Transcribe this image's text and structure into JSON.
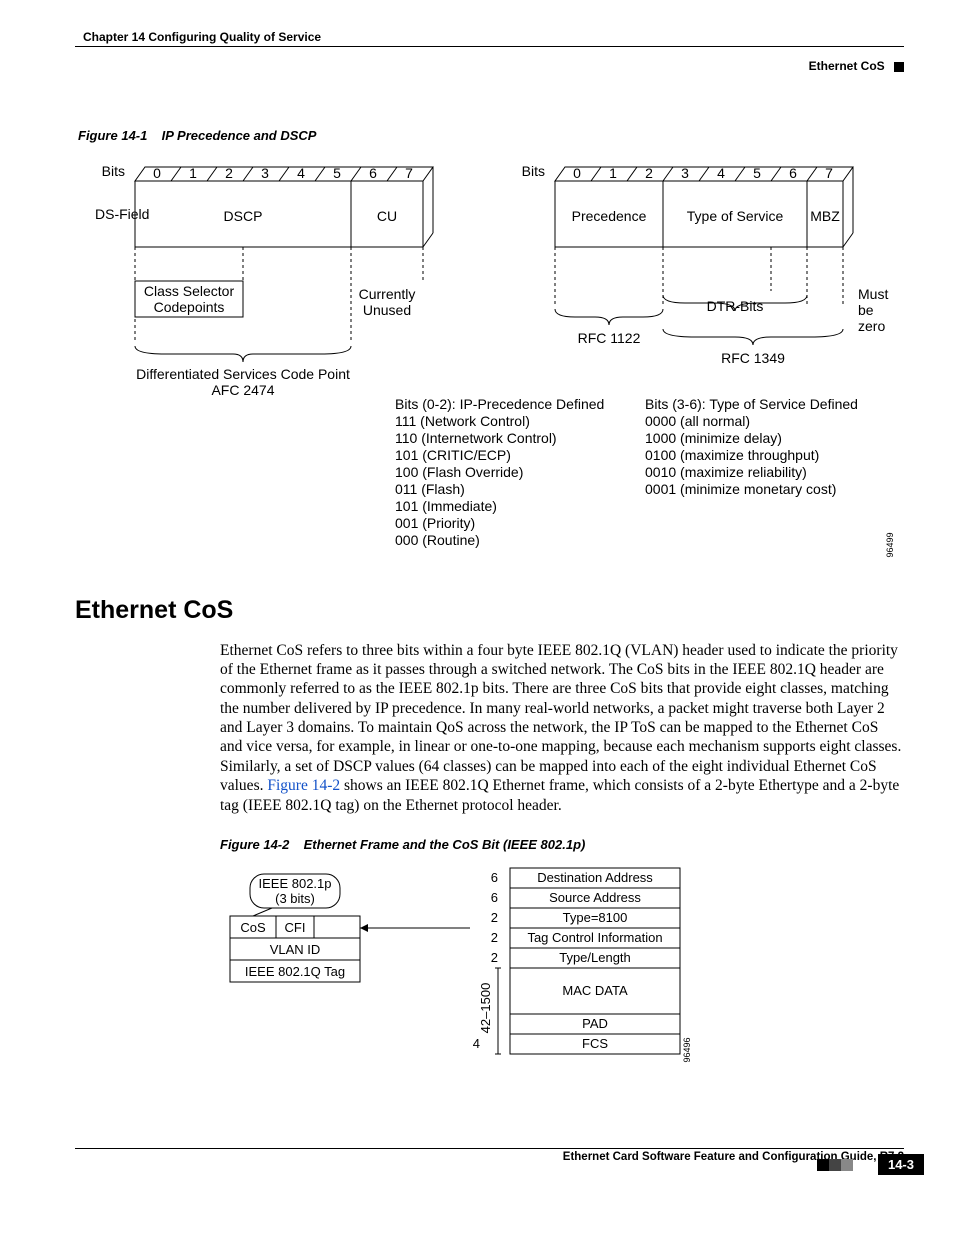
{
  "header": {
    "chapter": "Chapter 14 Configuring Quality of Service",
    "sectionName": "Ethernet CoS"
  },
  "figure1": {
    "caption_num": "Figure 14-1",
    "caption_title": "IP Precedence and DSCP",
    "leftBlock": {
      "bitsLabel": "Bits",
      "bits": [
        "0",
        "1",
        "2",
        "3",
        "4",
        "5",
        "6",
        "7"
      ],
      "rowLabel": "DS-Field",
      "cell1": "DSCP",
      "cell2": "CU",
      "underLeft1": "Class Selector",
      "underLeft2": "Codepoints",
      "underRight1": "Currently",
      "underRight2": "Unused",
      "bottom1": "Differentiated Services Code Point",
      "bottom2": "AFC 2474"
    },
    "rightBlock": {
      "bitsLabel": "Bits",
      "bits": [
        "0",
        "1",
        "2",
        "3",
        "4",
        "5",
        "6",
        "7"
      ],
      "cell1": "Precedence",
      "cell2": "Type of Service",
      "cell3": "MBZ",
      "rfc1": "RFC 1122",
      "dtr": "DTR-Bits",
      "mbz1": "Must",
      "mbz2": "be",
      "mbz3": "zero",
      "rfc2": "RFC 1349"
    },
    "listLeft": {
      "title": "Bits (0-2): IP-Precedence Defined",
      "items": [
        "111 (Network Control)",
        "110 (Internetwork Control)",
        "101 (CRITIC/ECP)",
        "100 (Flash Override)",
        "011 (Flash)",
        "101 (Immediate)",
        "001 (Priority)",
        "000 (Routine)"
      ]
    },
    "listRight": {
      "title": "Bits (3-6): Type of Service Defined",
      "items": [
        "0000 (all normal)",
        "1000 (minimize delay)",
        "0100 (maximize throughput)",
        "0010 (maximize reliability)",
        "0001 (minimize monetary cost)"
      ]
    },
    "imgcode": "96499"
  },
  "section": {
    "title": "Ethernet CoS",
    "p1a": "Ethernet CoS refers to three bits within a four byte IEEE 802.1Q (VLAN) header used to indicate the priority of the Ethernet frame as it passes through a switched network. The CoS bits in the IEEE 802.1Q header are commonly referred to as the IEEE 802.1p bits. There are three CoS bits that provide eight classes, matching the number delivered by IP precedence. In many real-world networks, a packet might traverse both Layer 2 and Layer 3 domains. To maintain QoS across the network, the IP ToS can be mapped to the Ethernet CoS and vice versa, for example, in linear or one-to-one mapping, because each mechanism supports eight classes. Similarly, a set of DSCP values (64 classes) can be mapped into each of the eight individual Ethernet CoS values. ",
    "p1link": "Figure 14-2",
    "p1b": " shows an IEEE 802.1Q Ethernet frame, which consists of a 2-byte Ethertype and a 2-byte tag (IEEE 802.1Q tag) on the Ethernet protocol header."
  },
  "figure2": {
    "caption_num": "Figure 14-2",
    "caption_title": "Ethernet Frame and the CoS Bit (IEEE 802.1p)",
    "tag": {
      "p1": "IEEE 802.1p",
      "p2": "(3 bits)",
      "cos": "CoS",
      "cfi": "CFI",
      "vlan": "VLAN ID",
      "bottom": "IEEE 802.1Q Tag"
    },
    "frame": {
      "rows": [
        {
          "size": "6",
          "label": "Destination Address"
        },
        {
          "size": "6",
          "label": "Source Address"
        },
        {
          "size": "2",
          "label": "Type=8100"
        },
        {
          "size": "2",
          "label": "Tag Control Information"
        },
        {
          "size": "2",
          "label": "Type/Length"
        },
        {
          "size": "42–1500",
          "label": "MAC DATA"
        },
        {
          "size": "",
          "label": "PAD"
        },
        {
          "size": "4",
          "label": "FCS"
        }
      ]
    },
    "imgcode": "96496"
  },
  "footer": {
    "guide": "Ethernet Card Software Feature and Configuration Guide, R7.2",
    "page": "14-3"
  }
}
